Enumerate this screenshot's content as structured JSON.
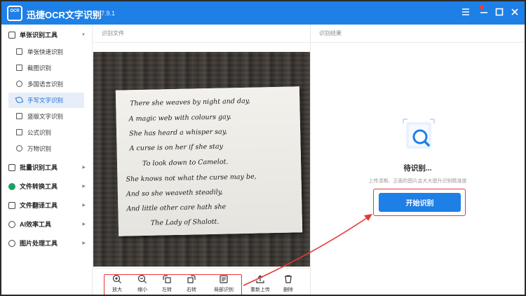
{
  "app": {
    "logo_text": "OCR",
    "title": "迅捷OCR文字识别",
    "version": "v8.7.9.1",
    "controls": [
      "menu-icon",
      "minimize-icon",
      "maximize-icon",
      "close-icon"
    ]
  },
  "sidebar": {
    "groups": [
      {
        "label": "单张识别工具",
        "icon": "image-icon",
        "expanded": true
      },
      {
        "label": "批量识别工具",
        "icon": "layers-icon"
      },
      {
        "label": "文件转换工具",
        "icon": "convert-icon"
      },
      {
        "label": "文件翻译工具",
        "icon": "translate-icon"
      },
      {
        "label": "AI效率工具",
        "icon": "ai-icon"
      },
      {
        "label": "图片处理工具",
        "icon": "palette-icon"
      }
    ],
    "items": [
      {
        "label": "单张快速识别",
        "icon": "image-icon"
      },
      {
        "label": "截图识别",
        "icon": "crop-icon"
      },
      {
        "label": "多国语言识别",
        "icon": "globe-icon"
      },
      {
        "label": "手写文字识别",
        "icon": "pen-icon",
        "active": true
      },
      {
        "label": "竖版文字识别",
        "icon": "vertical-text-icon"
      },
      {
        "label": "公式识别",
        "icon": "formula-icon"
      },
      {
        "label": "万物识别",
        "icon": "object-icon"
      }
    ]
  },
  "left_panel": {
    "title": "识别文件"
  },
  "right_panel": {
    "title": "识别结果",
    "status": "待识别...",
    "hint": "上传清晰、正面的图片会大大提升识别精准度",
    "start_button": "开始识别"
  },
  "handwriting": [
    "There she weaves by night and day,",
    "A magic web with colours gay.",
    "She has heard a whisper say,",
    "A curse is on her if she stay",
    "To look down to Camelot.",
    "She knows not what the curse may be,",
    "And so she weaveth steadily,",
    "And little other care hath she",
    "The Lady of Shalott."
  ],
  "toolbar": [
    {
      "label": "放大",
      "icon": "zoom-in-icon"
    },
    {
      "label": "缩小",
      "icon": "zoom-out-icon"
    },
    {
      "label": "左转",
      "icon": "rotate-left-icon"
    },
    {
      "label": "右转",
      "icon": "rotate-right-icon"
    },
    {
      "label": "局部识别",
      "icon": "partial-recognize-icon"
    },
    {
      "label": "重新上传",
      "icon": "upload-icon"
    },
    {
      "label": "删除",
      "icon": "delete-icon"
    }
  ],
  "colors": {
    "accent": "#1e7fe6",
    "highlight": "#e53935",
    "active_bg": "#e6eef9"
  }
}
